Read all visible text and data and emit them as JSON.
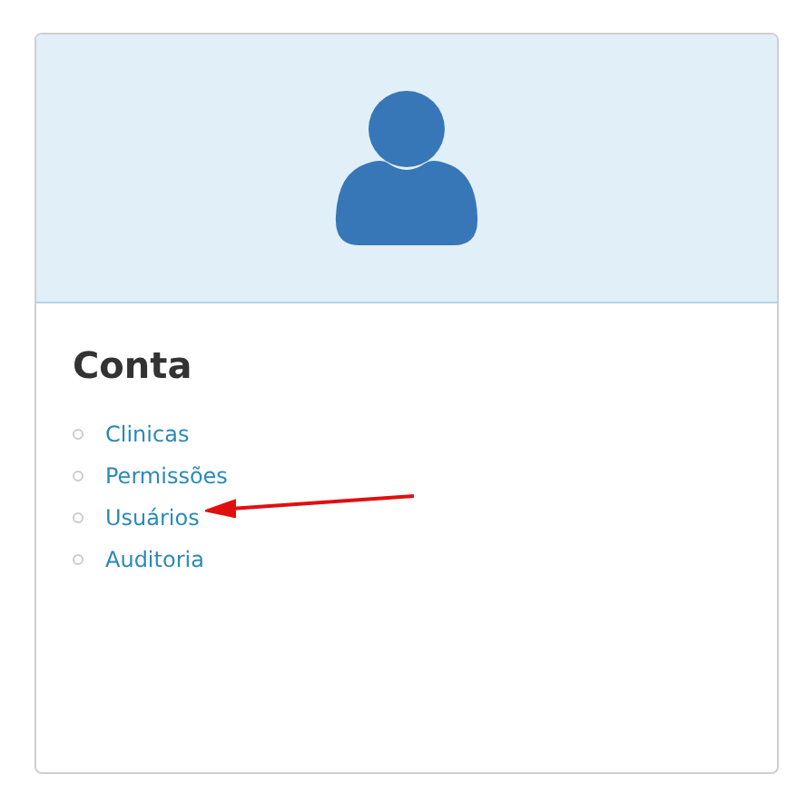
{
  "card": {
    "title": "Conta",
    "links": [
      {
        "label": "Clinicas"
      },
      {
        "label": "Permissões"
      },
      {
        "label": "Usuários"
      },
      {
        "label": "Auditoria"
      }
    ]
  }
}
